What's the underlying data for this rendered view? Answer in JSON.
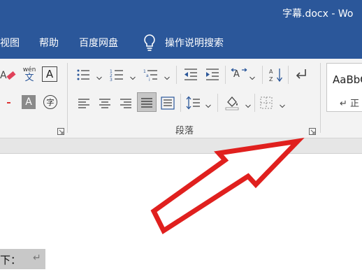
{
  "window": {
    "title": "字幕.docx  -  Wo"
  },
  "menu": {
    "items": [
      "视图",
      "帮助",
      "百度网盘"
    ],
    "tell_me": "操作说明搜索"
  },
  "ribbon": {
    "paragraph_group_label": "段落",
    "font_tiles": {
      "wen_pinyin": "wén",
      "wen_char": "文",
      "char_A": "A",
      "char_A_shaded": "A",
      "enclose_char": "字"
    },
    "styles": {
      "sample": "AaBbC",
      "name": "↵ 正"
    }
  },
  "document": {
    "text": "下：",
    "paragraph_mark": "↵"
  },
  "colors": {
    "brand": "#2b579a",
    "ribbon_bg": "#f3f3f3",
    "arrow_red": "#e0201e"
  },
  "icons": [
    "bulb-icon",
    "bullets-icon",
    "numbering-icon",
    "multilevel-list-icon",
    "decrease-indent-icon",
    "increase-indent-icon",
    "chinese-layout-icon",
    "sort-icon",
    "show-marks-icon",
    "align-left-icon",
    "center-icon",
    "align-right-icon",
    "justify-icon",
    "distributed-icon",
    "line-spacing-icon",
    "shading-icon",
    "borders-icon",
    "dialog-launcher-icon",
    "arrow-annotation"
  ]
}
